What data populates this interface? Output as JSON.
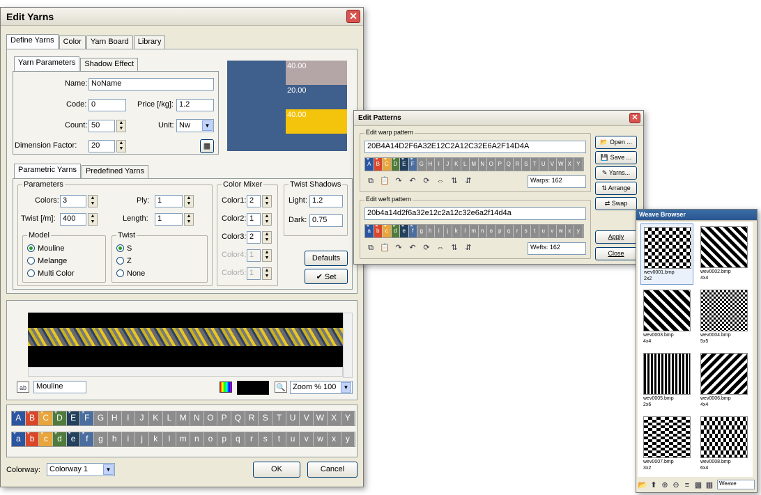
{
  "edit_yarns": {
    "title": "Edit Yarns",
    "close": "✕",
    "tabs": [
      "Define Yarns",
      "Color",
      "Yarn Board",
      "Library"
    ],
    "subtabs": [
      "Yarn Parameters",
      "Shadow Effect"
    ],
    "name_label": "Name:",
    "name_value": "NoName",
    "code_label": "Code:",
    "code_value": "0",
    "price_label": "Price [/kg]:",
    "price_value": "1.2",
    "count_label": "Count:",
    "count_value": "50",
    "unit_label": "Unit:",
    "unit_value": "Nw",
    "dim_label": "Dimension Factor:",
    "dim_value": "20",
    "preview_labels": [
      "40.00",
      "20.00",
      "40.00"
    ],
    "preview_colors": [
      "#b4a5a6",
      "#3f5f8c",
      "#f4c30c"
    ],
    "param_tabs": [
      "Parametric Yarns",
      "Predefined Yarns"
    ],
    "parameters_legend": "Parameters",
    "colors_label": "Colors:",
    "colors_value": "3",
    "ply_label": "Ply:",
    "ply_value": "1",
    "twist_label": "Twist [/m]:",
    "twist_value": "400",
    "length_label": "Length:",
    "length_value": "1",
    "model_legend": "Model",
    "model_options": [
      "Mouline",
      "Melange",
      "Multi Color"
    ],
    "twist_legend": "Twist",
    "twist_options": [
      "S",
      "Z",
      "None"
    ],
    "mixer_legend": "Color Mixer",
    "mixer": [
      {
        "label": "Color1:",
        "value": "2"
      },
      {
        "label": "Color2:",
        "value": "1"
      },
      {
        "label": "Color3:",
        "value": "2"
      },
      {
        "label": "Color4:",
        "value": "1"
      },
      {
        "label": "Color5:",
        "value": "1"
      }
    ],
    "shadows_legend": "Twist Shadows",
    "light_label": "Light:",
    "light_value": "1.2",
    "dark_label": "Dark:",
    "dark_value": "0.75",
    "defaults_button": "Defaults",
    "set_button": "Set",
    "yarn_name_value": "Mouline",
    "zoom_value": "Zoom % 100",
    "upper_letters": [
      "A",
      "B",
      "C",
      "D",
      "E",
      "F",
      "G",
      "H",
      "I",
      "J",
      "K",
      "L",
      "M",
      "N",
      "O",
      "P",
      "Q",
      "R",
      "S",
      "T",
      "U",
      "V",
      "W",
      "X",
      "Y"
    ],
    "lower_letters": [
      "a",
      "b",
      "c",
      "d",
      "e",
      "f",
      "g",
      "h",
      "i",
      "j",
      "k",
      "l",
      "m",
      "n",
      "o",
      "p",
      "q",
      "r",
      "s",
      "t",
      "u",
      "v",
      "w",
      "x",
      "y"
    ],
    "letter_colors": [
      "#2b55a0",
      "#d9472b",
      "#e8a53c",
      "#4f7b3c",
      "#23415c",
      "#4b6e9e"
    ],
    "colorway_label": "Colorway:",
    "colorway_value": "Colorway 1",
    "ok_button": "OK",
    "cancel_button": "Cancel"
  },
  "edit_patterns": {
    "title": "Edit Patterns",
    "warp_legend": "Edit warp pattern",
    "warp_value": "20B4A14D2F6A32E12C2A12C32E6A2F14D4A",
    "warps_label": "Warps: 162",
    "weft_legend": "Edit weft pattern",
    "weft_value": "20b4a14d2f6a32e12c2a12c32e6a2f14d4a",
    "wefts_label": "Wefts: 162",
    "upper_letters": [
      "A",
      "B",
      "C",
      "D",
      "E",
      "F",
      "G",
      "H",
      "I",
      "J",
      "K",
      "L",
      "M",
      "N",
      "O",
      "P",
      "Q",
      "R",
      "S",
      "T",
      "U",
      "V",
      "W",
      "X",
      "Y"
    ],
    "lower_letters": [
      "a",
      "b",
      "c",
      "d",
      "e",
      "f",
      "g",
      "h",
      "i",
      "j",
      "k",
      "l",
      "m",
      "n",
      "o",
      "p",
      "q",
      "r",
      "s",
      "t",
      "u",
      "v",
      "w",
      "x",
      "y"
    ],
    "side_buttons": [
      "Open ...",
      "Save ...",
      "Yarns...",
      "Arrange",
      "Swap"
    ],
    "apply_button": "Apply",
    "close_button": "Close"
  },
  "weave_browser": {
    "title": "Weave Browser",
    "items": [
      {
        "file": "wev0001.bmp",
        "size": "2x2"
      },
      {
        "file": "wev0002.bmp",
        "size": "4x4"
      },
      {
        "file": "wev0003.bmp",
        "size": "4x4"
      },
      {
        "file": "wev0004.bmp",
        "size": "5x5"
      },
      {
        "file": "wev0005.bmp",
        "size": "2x6"
      },
      {
        "file": "wev0006.bmp",
        "size": "4x4"
      },
      {
        "file": "wev0007.bmp",
        "size": "3x2"
      },
      {
        "file": "wev0008.bmp",
        "size": "6x4"
      }
    ],
    "filter_value": "Weave"
  }
}
